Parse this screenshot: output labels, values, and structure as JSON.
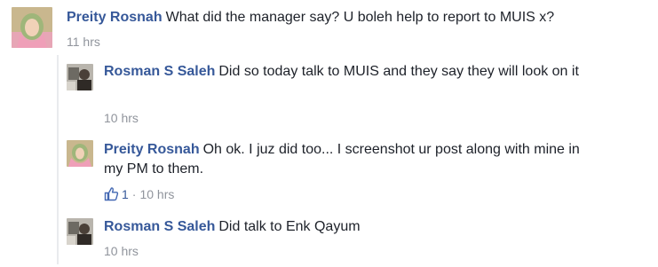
{
  "comments": [
    {
      "author": "Preity Rosnah",
      "text": "What did the manager say? U boleh help to report to MUIS x?",
      "time": "11 hrs",
      "avatar": "female-profile-avatar"
    },
    {
      "author": "Rosman S Saleh",
      "text": "Did so today talk to MUIS and they say they will look on it",
      "time": "10 hrs",
      "avatar": "male-profile-avatar"
    },
    {
      "author": "Preity Rosnah",
      "text": "Oh ok. I juz did too... I screenshot ur post along with mine in my PM to them.",
      "time": "10 hrs",
      "likes": "1",
      "avatar": "female-profile-avatar"
    },
    {
      "author": "Rosman S Saleh",
      "text": "Did talk to Enk Qayum",
      "time": "10 hrs",
      "avatar": "male-profile-avatar"
    }
  ],
  "colors": {
    "author": "#365899",
    "meta": "#90949c",
    "text": "#1d2129",
    "thread_line": "#e9ebee"
  }
}
